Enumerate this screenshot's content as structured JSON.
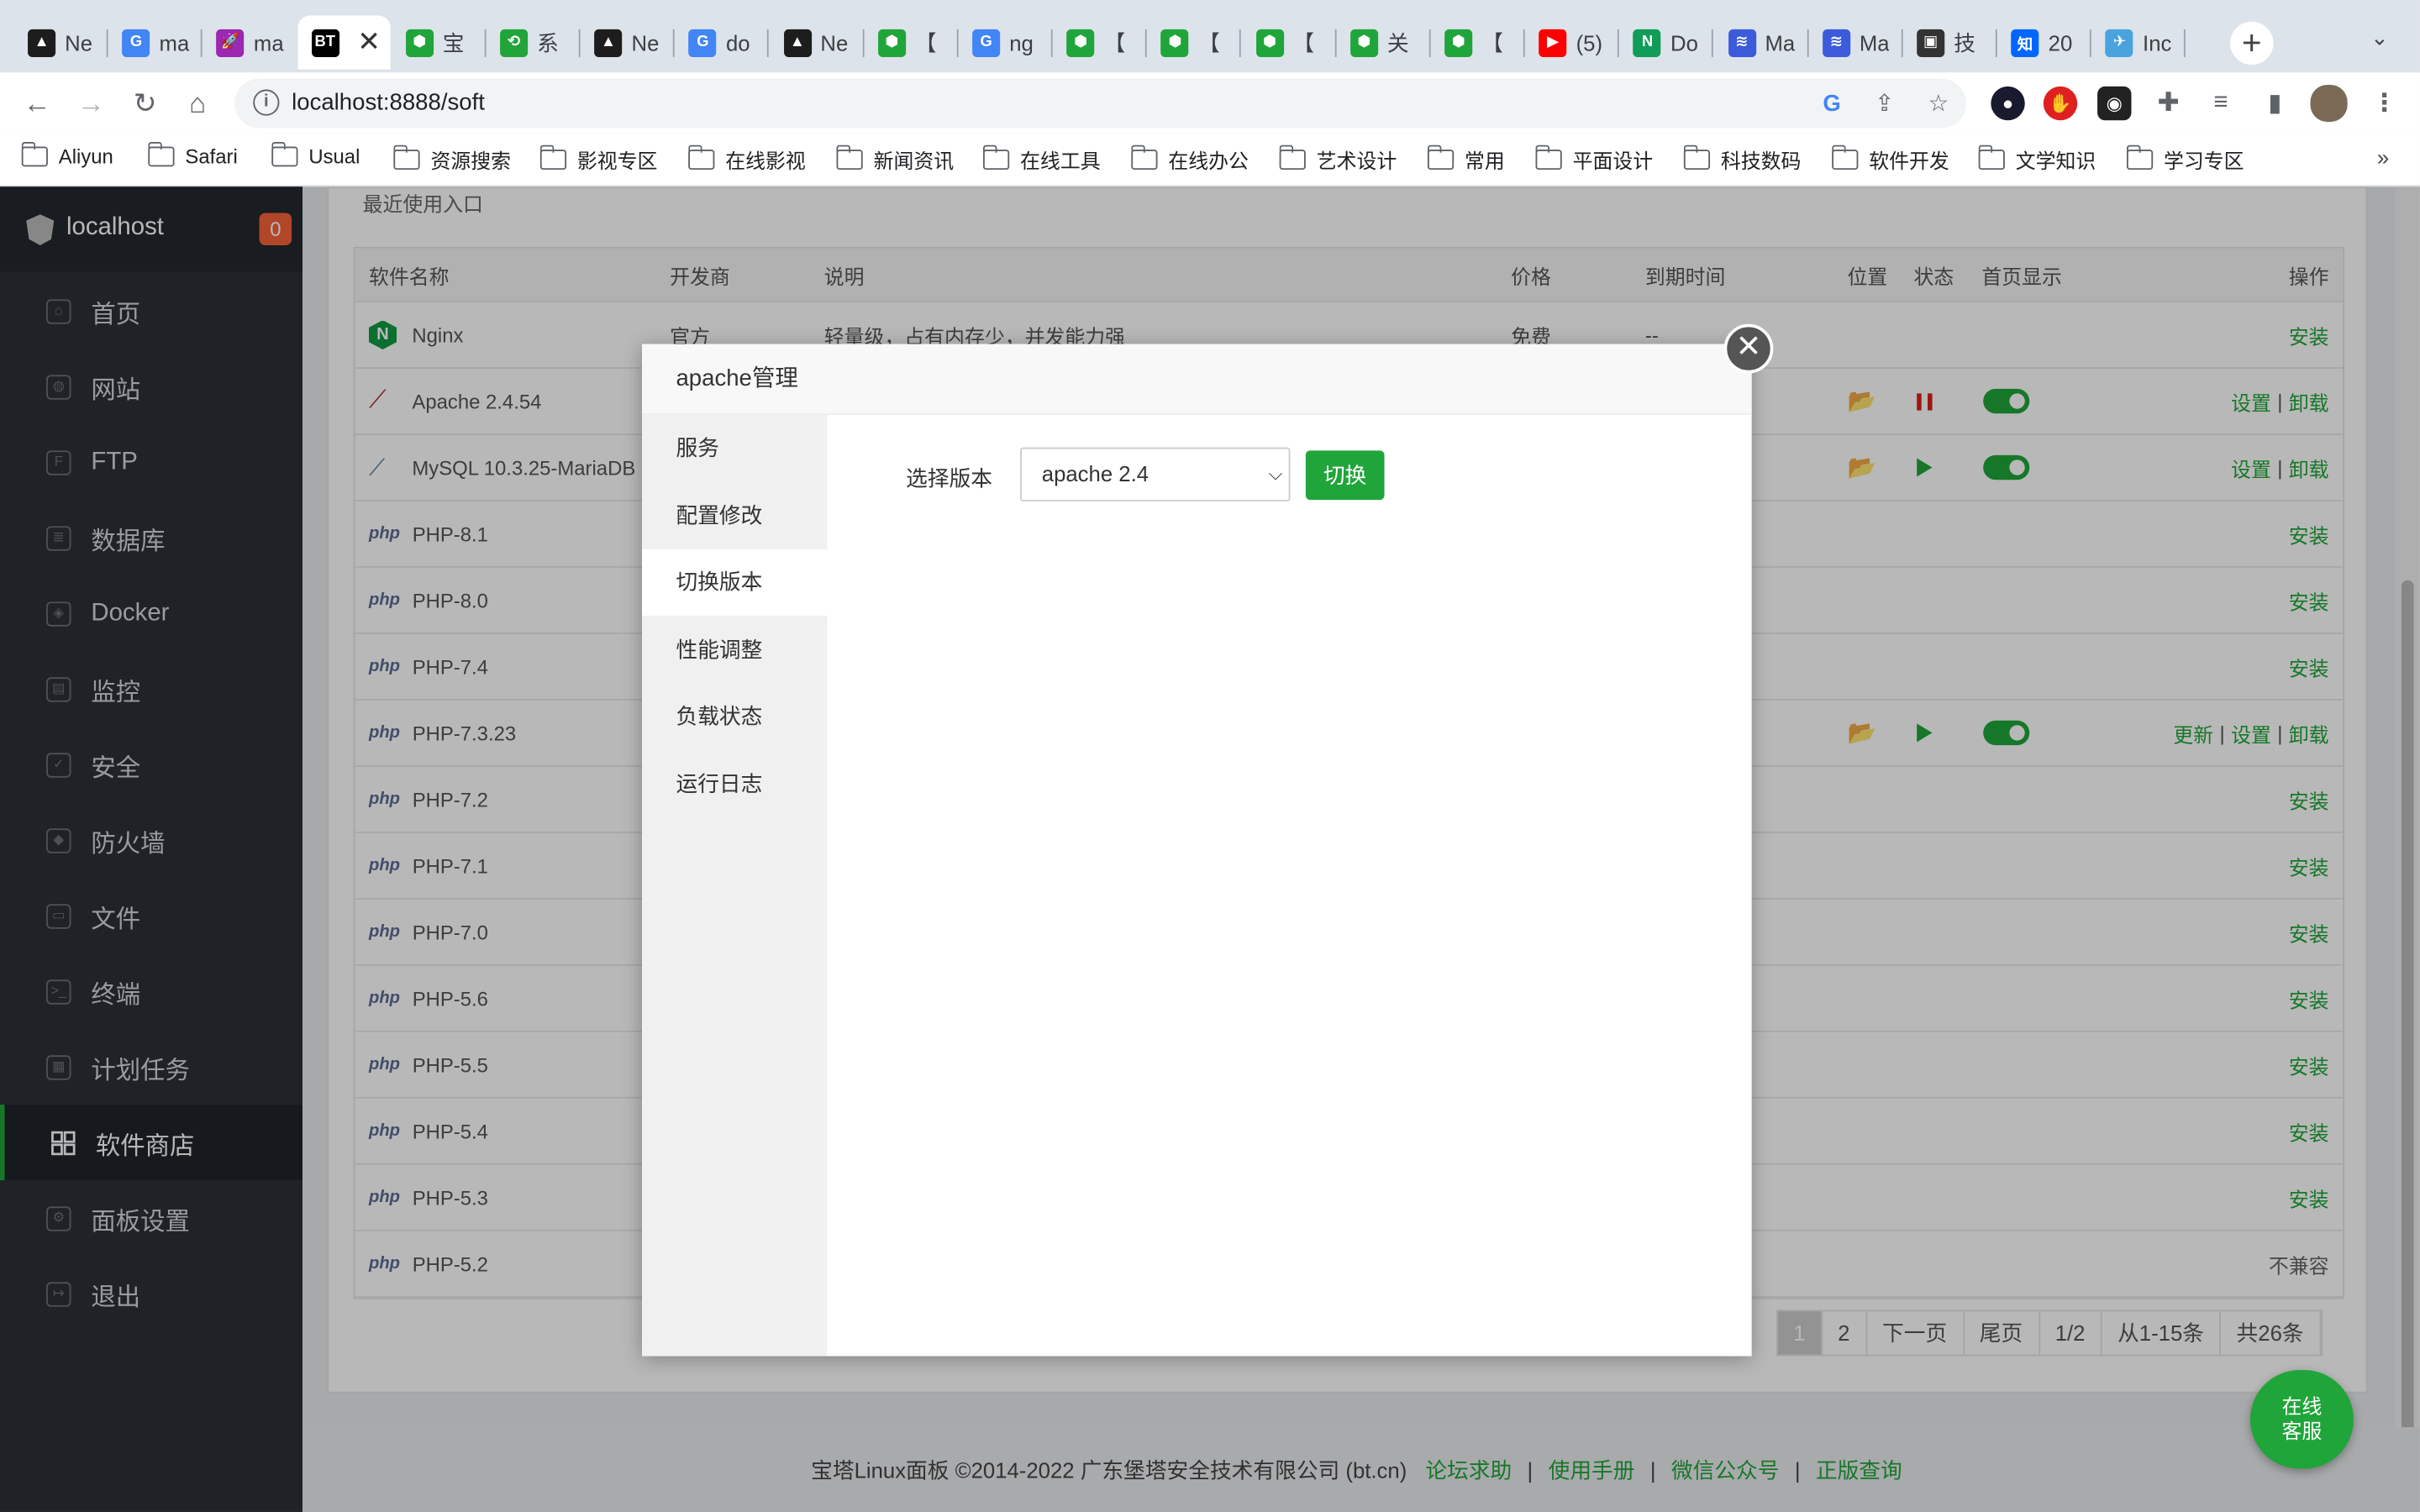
{
  "browser": {
    "tabs": [
      {
        "label": "Ne",
        "color": "#1d1d1d",
        "glyph": "▲"
      },
      {
        "label": "ma",
        "color": "#4285f4",
        "glyph": "G"
      },
      {
        "label": "ma",
        "color": "#9c27b0",
        "glyph": "🚀"
      },
      {
        "label": "",
        "color": "#000000",
        "glyph": "BT"
      },
      {
        "label": "宝",
        "color": "#20a53a",
        "glyph": "⬢"
      },
      {
        "label": "系",
        "color": "#20a53a",
        "glyph": "⟲"
      },
      {
        "label": "Ne",
        "color": "#1d1d1d",
        "glyph": "▲"
      },
      {
        "label": "do",
        "color": "#4285f4",
        "glyph": "G"
      },
      {
        "label": "Ne",
        "color": "#1d1d1d",
        "glyph": "▲"
      },
      {
        "label": "【",
        "color": "#20a53a",
        "glyph": "⬢"
      },
      {
        "label": "ng",
        "color": "#4285f4",
        "glyph": "G"
      },
      {
        "label": "【",
        "color": "#20a53a",
        "glyph": "⬢"
      },
      {
        "label": "【",
        "color": "#20a53a",
        "glyph": "⬢"
      },
      {
        "label": "【",
        "color": "#20a53a",
        "glyph": "⬢"
      },
      {
        "label": "关",
        "color": "#20a53a",
        "glyph": "⬢"
      },
      {
        "label": "【",
        "color": "#20a53a",
        "glyph": "⬢"
      },
      {
        "label": "(5)",
        "color": "#ff0000",
        "glyph": "▶"
      },
      {
        "label": "Do",
        "color": "#0f9d58",
        "glyph": "N"
      },
      {
        "label": "Ma",
        "color": "#3b5bdb",
        "glyph": "≋"
      },
      {
        "label": "Ma",
        "color": "#3b5bdb",
        "glyph": "≋"
      },
      {
        "label": "技",
        "color": "#333333",
        "glyph": "▣"
      },
      {
        "label": "20",
        "color": "#0066ff",
        "glyph": "知"
      },
      {
        "label": "Inc",
        "color": "#4aa3df",
        "glyph": "✈"
      }
    ],
    "active_tab_close": "✕",
    "new_tab": "+",
    "tab_menu": "⌄",
    "url": "localhost:8888/soft",
    "bookmarks": [
      "Aliyun",
      "Safari",
      "Usual",
      "资源搜索",
      "影视专区",
      "在线影视",
      "新闻资讯",
      "在线工具",
      "在线办公",
      "艺术设计",
      "常用",
      "平面设计",
      "科技数码",
      "软件开发",
      "文学知识",
      "学习专区"
    ],
    "bookmarks_more": "»"
  },
  "sidebar": {
    "host": "localhost",
    "badge": "0",
    "items": [
      {
        "label": "首页",
        "icon": "home-icon"
      },
      {
        "label": "网站",
        "icon": "globe-icon"
      },
      {
        "label": "FTP",
        "icon": "ftp-icon"
      },
      {
        "label": "数据库",
        "icon": "database-icon"
      },
      {
        "label": "Docker",
        "icon": "docker-icon"
      },
      {
        "label": "监控",
        "icon": "monitor-icon"
      },
      {
        "label": "安全",
        "icon": "shield-icon"
      },
      {
        "label": "防火墙",
        "icon": "firewall-icon"
      },
      {
        "label": "文件",
        "icon": "folder-icon"
      },
      {
        "label": "终端",
        "icon": "terminal-icon"
      },
      {
        "label": "计划任务",
        "icon": "calendar-icon"
      },
      {
        "label": "软件商店",
        "icon": "grid-icon"
      },
      {
        "label": "面板设置",
        "icon": "gear-icon"
      },
      {
        "label": "退出",
        "icon": "logout-icon"
      }
    ],
    "active_index": 11
  },
  "main": {
    "recent_title": "最近使用入口",
    "table": {
      "headers": {
        "name": "软件名称",
        "developer": "开发商",
        "desc": "说明",
        "price": "价格",
        "expire": "到期时间",
        "location": "位置",
        "status": "状态",
        "home": "首页显示",
        "ops": "操作"
      },
      "rows": [
        {
          "name": "Nginx",
          "icon": "nginx",
          "developer": "官方",
          "desc": "轻量级，占有内存少，并发能力强",
          "price": "免费",
          "expire": "--",
          "ops": [
            "安装"
          ]
        },
        {
          "name": "Apache 2.4.54",
          "icon": "apache",
          "developer": "",
          "desc": "",
          "price": "",
          "expire": "",
          "folder": true,
          "status": "stop",
          "toggle": true,
          "ops": [
            "设置",
            "卸载"
          ]
        },
        {
          "name": "MySQL 10.3.25-MariaDB",
          "icon": "mysql",
          "developer": "",
          "desc": "",
          "price": "",
          "expire": "",
          "folder": true,
          "status": "play",
          "toggle": true,
          "ops": [
            "设置",
            "卸载"
          ]
        },
        {
          "name": "PHP-8.1",
          "icon": "php",
          "ops": [
            "安装"
          ]
        },
        {
          "name": "PHP-8.0",
          "icon": "php",
          "ops": [
            "安装"
          ]
        },
        {
          "name": "PHP-7.4",
          "icon": "php",
          "ops": [
            "安装"
          ]
        },
        {
          "name": "PHP-7.3.23",
          "icon": "php",
          "folder": true,
          "status": "play",
          "toggle": true,
          "ops": [
            "更新",
            "设置",
            "卸载"
          ]
        },
        {
          "name": "PHP-7.2",
          "icon": "php",
          "ops": [
            "安装"
          ]
        },
        {
          "name": "PHP-7.1",
          "icon": "php",
          "ops": [
            "安装"
          ]
        },
        {
          "name": "PHP-7.0",
          "icon": "php",
          "ops": [
            "安装"
          ]
        },
        {
          "name": "PHP-5.6",
          "icon": "php",
          "ops": [
            "安装"
          ]
        },
        {
          "name": "PHP-5.5",
          "icon": "php",
          "ops": [
            "安装"
          ]
        },
        {
          "name": "PHP-5.4",
          "icon": "php",
          "ops": [
            "安装"
          ]
        },
        {
          "name": "PHP-5.3",
          "icon": "php",
          "ops": [
            "安装"
          ]
        },
        {
          "name": "PHP-5.2",
          "icon": "php",
          "ops": [],
          "incompat": "不兼容"
        }
      ]
    },
    "pager": [
      "1",
      "2",
      "下一页",
      "尾页",
      "1/2",
      "从1-15条",
      "共26条"
    ],
    "php_label": "php"
  },
  "footer": {
    "copyright": "宝塔Linux面板 ©2014-2022 广东堡塔安全技术有限公司 (bt.cn)",
    "links": [
      "论坛求助",
      "使用手册",
      "微信公众号",
      "正版查询"
    ],
    "sep": "|"
  },
  "kefu": [
    "在线",
    "客服"
  ],
  "modal": {
    "title": "apache管理",
    "close": "✕",
    "nav": [
      "服务",
      "配置修改",
      "切换版本",
      "性能调整",
      "负载状态",
      "运行日志"
    ],
    "active_nav": 2,
    "version_label": "选择版本",
    "version_value": "apache 2.4",
    "switch_button": "切换"
  },
  "colors": {
    "accent": "#20a53a",
    "sidebar": "#2c3138",
    "badge": "#f7613a"
  }
}
